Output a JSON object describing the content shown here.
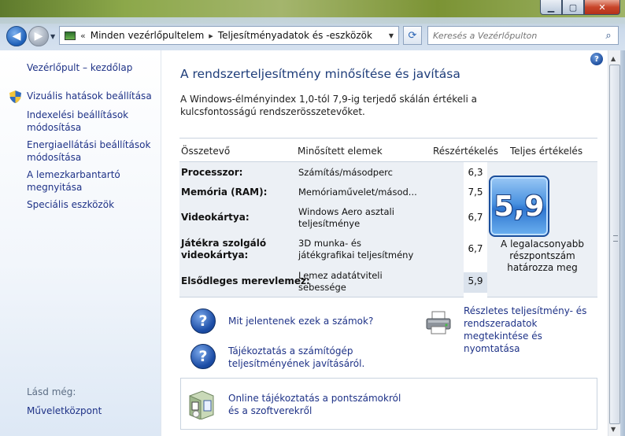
{
  "window": {
    "controls": {
      "minimize": "▁",
      "maximize": "▢",
      "close": "✕"
    }
  },
  "nav": {
    "back_icon": "back-arrow-icon",
    "forward_icon": "forward-arrow-icon",
    "address": {
      "prefix": "«",
      "crumbs": [
        "Minden vezérlőpultelem",
        "Teljesítményadatok és -eszközök"
      ],
      "separator": "▸"
    },
    "search_placeholder": "Keresés a Vezérlőpulton"
  },
  "sidebar": {
    "home": "Vezérlőpult – kezdőlap",
    "items": [
      {
        "label": "Vizuális hatások beállítása",
        "icon": "shield-icon"
      },
      {
        "label": "Indexelési beállítások módosítása"
      },
      {
        "label": "Energiaellátási beállítások módosítása"
      },
      {
        "label": "A lemezkarbantartó megnyitása"
      },
      {
        "label": "Speciális eszközök"
      }
    ],
    "see_also": "Lásd még:",
    "see_also_links": [
      "Műveletközpont"
    ]
  },
  "main": {
    "title": "A rendszerteljesítmény minősítése és javítása",
    "description": "A Windows-élményindex 1,0-tól 7,9-ig terjedő skálán értékeli a kulcsfontosságú rendszerösszetevőket.",
    "table": {
      "headers": [
        "Összetevő",
        "Minősített elemek",
        "Részértékelés",
        "Teljes értékelés"
      ],
      "rows": [
        {
          "component": "Processzor:",
          "rated": "Számítás/másodperc",
          "subscore": "6,3"
        },
        {
          "component": "Memória (RAM):",
          "rated": "Memóriaművelet/másod...",
          "subscore": "7,5"
        },
        {
          "component": "Videokártya:",
          "rated": "Windows Aero asztali teljesítménye",
          "subscore": "6,7"
        },
        {
          "component": "Játékra szolgáló videokártya:",
          "rated": "3D munka- és játékgrafikai teljesítmény",
          "subscore": "6,7"
        },
        {
          "component": "Elsődleges merevlemez:",
          "rated": "Lemez adatátviteli sebessége",
          "subscore": "5,9"
        }
      ],
      "base_score": "5,9",
      "base_score_note": "A legalacsonyabb részpontszám határozza meg"
    },
    "links": {
      "what_mean": "Mit jelentenek ezek a számok?",
      "tips": "Tájékoztatás a számítógép teljesítményének javításáról.",
      "details": "Részletes teljesítmény- és rendszeradatok megtekintése és nyomtatása",
      "online": "Online tájékoztatás a pontszámokról és a szoftverekről"
    }
  }
}
